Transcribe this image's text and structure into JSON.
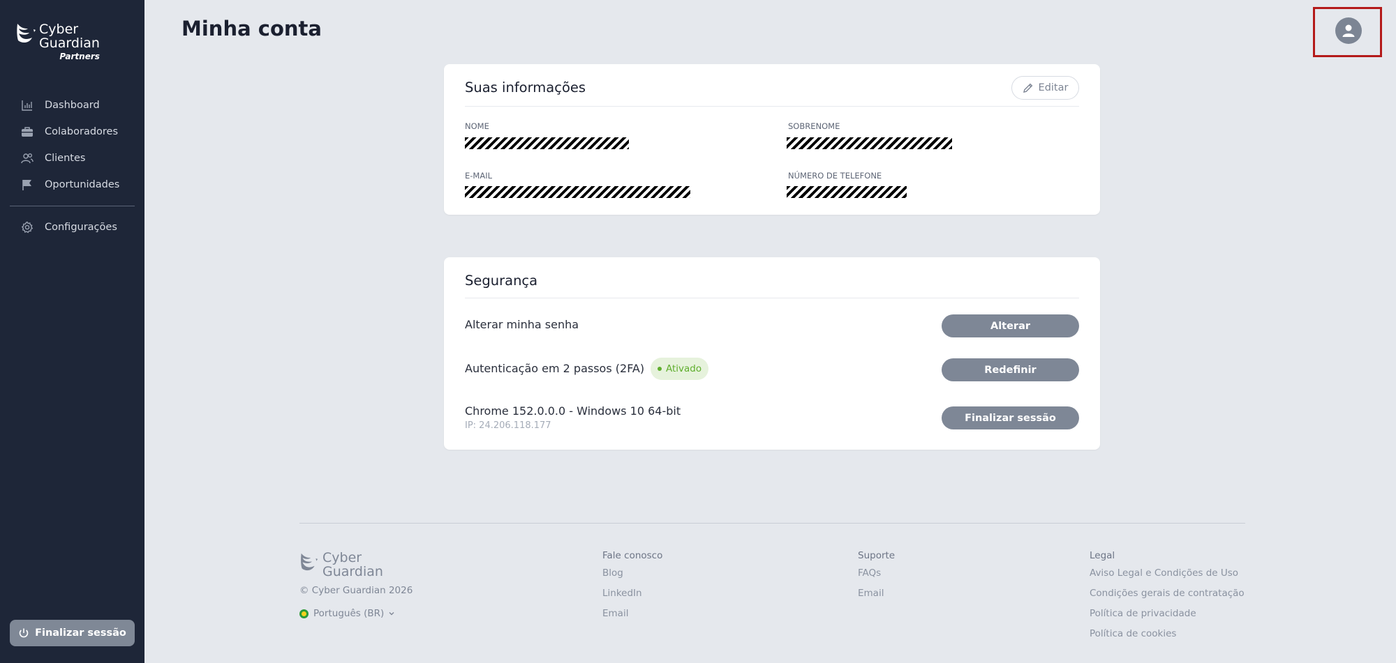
{
  "app": {
    "brand_line1": "Cyber",
    "brand_line2": "Guardian",
    "brand_line3": "Partners"
  },
  "sidebar": {
    "items": [
      {
        "label": "Dashboard",
        "icon": "bar-chart-icon"
      },
      {
        "label": "Colaboradores",
        "icon": "briefcase-icon"
      },
      {
        "label": "Clientes",
        "icon": "users-icon"
      },
      {
        "label": "Oportunidades",
        "icon": "flag-icon"
      }
    ],
    "settings": {
      "label": "Configurações",
      "icon": "gear-icon"
    },
    "logout_label": "Finalizar sessão"
  },
  "header": {
    "title": "Minha conta",
    "avatar_icon": "user-icon"
  },
  "info_card": {
    "title": "Suas informações",
    "edit_label": "Editar",
    "fields": {
      "first_name_label": "NOME",
      "last_name_label": "SOBRENOME",
      "email_label": "E-MAIL",
      "phone_label": "NÚMERO DE TELEFONE"
    }
  },
  "security_card": {
    "title": "Segurança",
    "password_label": "Alterar minha senha",
    "password_button": "Alterar",
    "twofa_label": "Autenticação em 2 passos (2FA)",
    "twofa_badge": "Ativado",
    "twofa_button": "Redefinir",
    "session_label": "Chrome 152.0.0.0 - Windows 10 64-bit",
    "session_ip": "IP: 24.206.118.177",
    "session_button": "Finalizar sessão"
  },
  "footer": {
    "brand_line1": "Cyber",
    "brand_line2": "Guardian",
    "copyright": "© Cyber Guardian 2026",
    "language": "Português (BR)",
    "contact": {
      "title": "Fale conosco",
      "links": [
        "Blog",
        "LinkedIn",
        "Email"
      ]
    },
    "support": {
      "title": "Suporte",
      "links": [
        "FAQs",
        "Email"
      ]
    },
    "legal": {
      "title": "Legal",
      "links": [
        "Aviso Legal e Condições de Uso",
        "Condições gerais de contratação",
        "Política de privacidade",
        "Política de cookies"
      ]
    }
  },
  "colors": {
    "sidebar_bg": "#1e2638",
    "page_bg": "#e5e8ed",
    "button_gray": "#7e8796",
    "badge_green": "#5fae2d",
    "highlight_red": "#b41a1a"
  }
}
